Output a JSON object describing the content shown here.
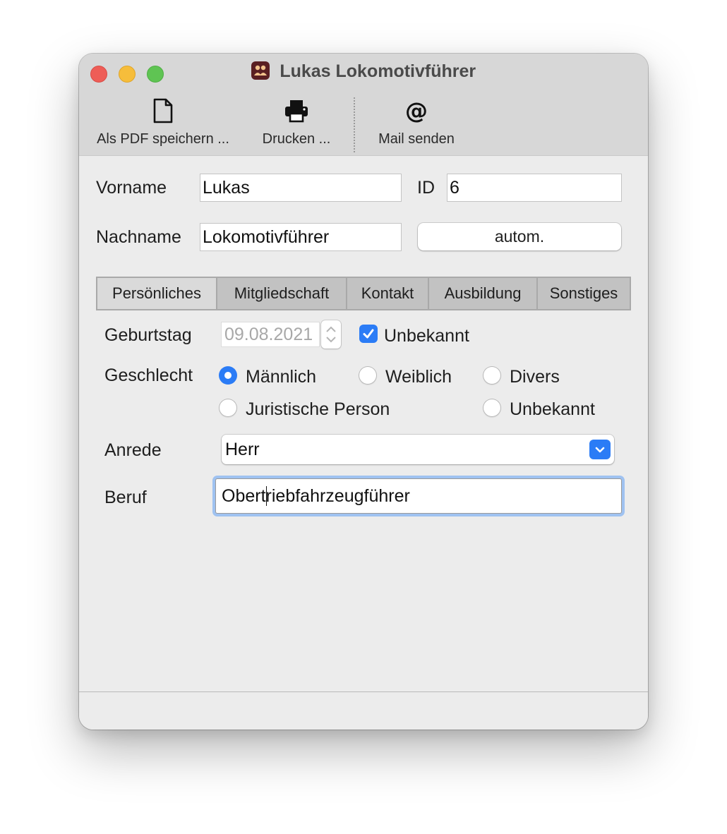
{
  "window": {
    "title": "Lukas Lokomotivführer"
  },
  "toolbar": {
    "save_pdf_label": "Als PDF speichern ...",
    "print_label": "Drucken ...",
    "mail_label": "Mail senden"
  },
  "form": {
    "vorname_label": "Vorname",
    "vorname_value": "Lukas",
    "id_label": "ID",
    "id_value": "6",
    "nachname_label": "Nachname",
    "nachname_value": "Lokomotivführer",
    "autom_button": "autom."
  },
  "tabs": [
    {
      "label": "Persönliches",
      "active": true
    },
    {
      "label": "Mitgliedschaft",
      "active": false
    },
    {
      "label": "Kontakt",
      "active": false
    },
    {
      "label": "Ausbildung",
      "active": false
    },
    {
      "label": "Sonstiges",
      "active": false
    }
  ],
  "personal": {
    "geburtstag_label": "Geburtstag",
    "geburtstag_value": "09.08.2021",
    "unbekannt_checkbox_label": "Unbekannt",
    "unbekannt_checked": true,
    "geschlecht_label": "Geschlecht",
    "gender_options": {
      "maennlich": "Männlich",
      "weiblich": "Weiblich",
      "divers": "Divers",
      "juristisch": "Juristische Person",
      "unbekannt": "Unbekannt"
    },
    "gender_selected": "Männlich",
    "anrede_label": "Anrede",
    "anrede_value": "Herr",
    "beruf_label": "Beruf",
    "beruf_before_caret": "Obert",
    "beruf_after_caret": "riebfahrzeugführer"
  },
  "colors": {
    "accent": "#2b7cf6",
    "focus_ring": "#9fc2f1",
    "close": "#ee5d57",
    "minimize": "#f6bd3b",
    "zoom": "#5fc453"
  }
}
